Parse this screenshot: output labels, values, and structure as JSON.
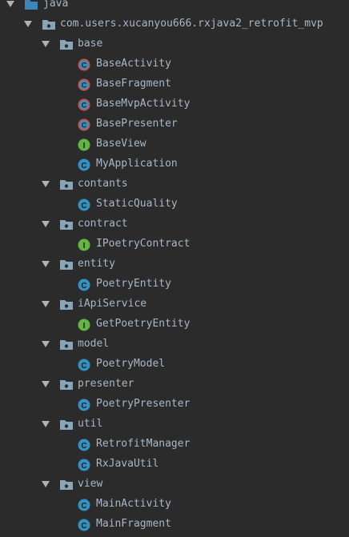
{
  "tree": {
    "java": "java",
    "root_package": "com.users.xucanyou666.rxjava2_retrofit_mvp",
    "packages": {
      "base": {
        "name": "base",
        "items": [
          "BaseActivity",
          "BaseFragment",
          "BaseMvpActivity",
          "BasePresenter",
          "BaseView",
          "MyApplication"
        ]
      },
      "contants": {
        "name": "contants",
        "items": [
          "StaticQuality"
        ]
      },
      "contract": {
        "name": "contract",
        "items": [
          "IPoetryContract"
        ]
      },
      "entity": {
        "name": "entity",
        "items": [
          "PoetryEntity"
        ]
      },
      "iApiService": {
        "name": "iApiService",
        "items": [
          "GetPoetryEntity"
        ]
      },
      "model": {
        "name": "model",
        "items": [
          "PoetryModel"
        ]
      },
      "presenter": {
        "name": "presenter",
        "items": [
          "PoetryPresenter"
        ]
      },
      "util": {
        "name": "util",
        "items": [
          "RetrofitManager",
          "RxJavaUtil"
        ]
      },
      "view": {
        "name": "view",
        "items": [
          "MainActivity",
          "MainFragment"
        ]
      }
    }
  },
  "icon_letters": {
    "class": "C",
    "interface": "I"
  },
  "colors": {
    "background": "#2b2b2b",
    "text": "#a9b7c6",
    "arrow": "#aeb2b5",
    "folder": "#88a6b8",
    "class_icon": "#3591c2",
    "abstract_class_ring": "#c75450",
    "interface_icon": "#62b543"
  }
}
